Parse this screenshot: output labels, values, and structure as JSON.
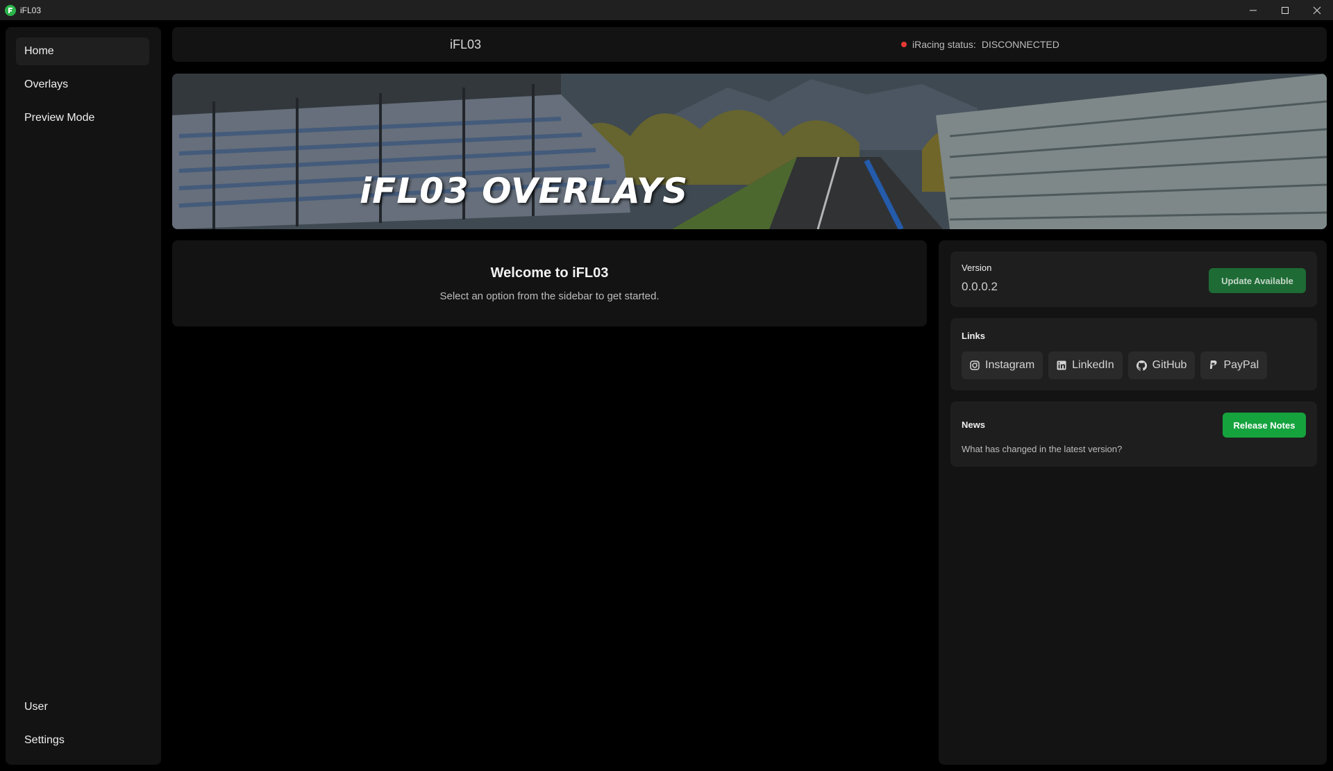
{
  "window": {
    "title": "iFL03",
    "icon": "app-logo-icon",
    "controls": [
      "minimize-icon",
      "maximize-icon",
      "close-icon"
    ]
  },
  "sidebar": {
    "top_items": [
      {
        "label": "Home",
        "active": true
      },
      {
        "label": "Overlays",
        "active": false
      },
      {
        "label": "Preview Mode",
        "active": false
      }
    ],
    "bottom_items": [
      {
        "label": "User"
      },
      {
        "label": "Settings"
      }
    ]
  },
  "header": {
    "app_name": "iFL03",
    "status_label": "iRacing status:",
    "status_value": "DISCONNECTED",
    "status_color": "#e53935"
  },
  "banner": {
    "title": "iFL03 OVERLAYS"
  },
  "welcome": {
    "title": "Welcome to iFL03",
    "subtitle": "Select an option from the sidebar to get started."
  },
  "version_card": {
    "label": "Version",
    "value": "0.0.0.2",
    "button_label": "Update Available",
    "button_color": "#1e6b35"
  },
  "links_card": {
    "label": "Links",
    "links": [
      {
        "label": "Instagram",
        "icon": "instagram-icon"
      },
      {
        "label": "LinkedIn",
        "icon": "linkedin-icon"
      },
      {
        "label": "GitHub",
        "icon": "github-icon"
      },
      {
        "label": "PayPal",
        "icon": "paypal-icon"
      }
    ]
  },
  "news_card": {
    "label": "News",
    "button_label": "Release Notes",
    "button_color": "#15a33e",
    "text": "What has changed in the latest version?"
  }
}
